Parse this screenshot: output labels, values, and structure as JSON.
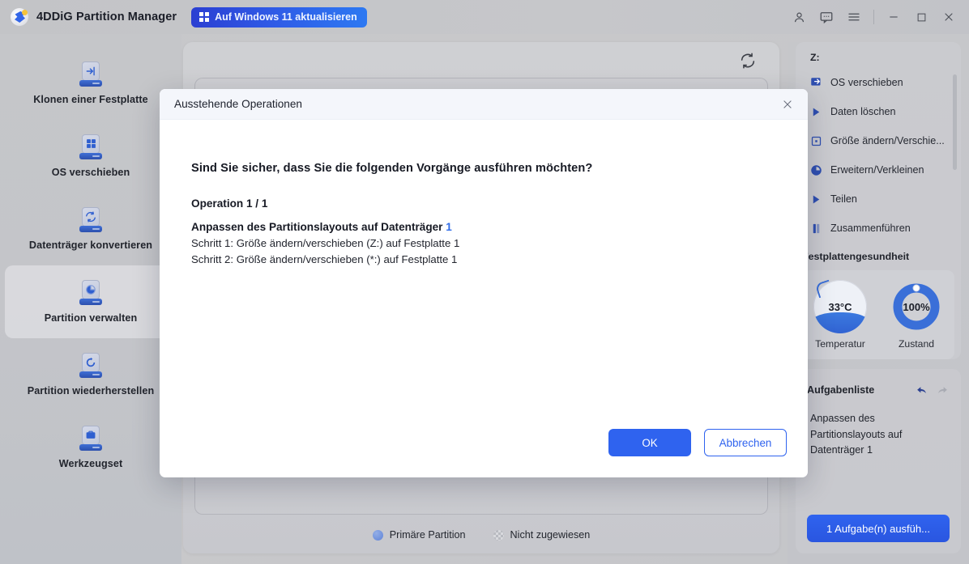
{
  "titlebar": {
    "app_title": "4DDiG Partition Manager",
    "upgrade_label": "Auf Windows 11 aktualisieren",
    "icons": {
      "account": "account-icon",
      "feedback": "feedback-icon",
      "menu": "hamburger-menu-icon",
      "minimize": "minimize-icon",
      "maximize": "maximize-icon",
      "close": "close-icon"
    }
  },
  "sidebar": {
    "items": [
      {
        "label": "Klonen einer Festplatte",
        "icon": "clone-disk-icon",
        "active": false
      },
      {
        "label": "OS verschieben",
        "icon": "migrate-os-icon",
        "active": false
      },
      {
        "label": "Datenträger konvertieren",
        "icon": "convert-disk-icon",
        "active": false
      },
      {
        "label": "Partition verwalten",
        "icon": "manage-partition-icon",
        "active": true
      },
      {
        "label": "Partition wiederherstellen",
        "icon": "recover-partition-icon",
        "active": false
      },
      {
        "label": "Werkzeugset",
        "icon": "toolkit-icon",
        "active": false
      }
    ]
  },
  "main": {
    "refresh_icon": "refresh-icon",
    "legend": [
      {
        "label": "Primäre Partition",
        "swatch": "primary"
      },
      {
        "label": "Nicht zugewiesen",
        "swatch": "unalloc"
      }
    ]
  },
  "right_panel": {
    "drive_label": "Z:",
    "menu": [
      {
        "label": "OS verschieben",
        "icon": "migrate-os-icon"
      },
      {
        "label": "Daten löschen",
        "icon": "wipe-data-icon"
      },
      {
        "label": "Größe ändern/Verschie...",
        "icon": "resize-move-icon"
      },
      {
        "label": "Erweitern/Verkleinen",
        "icon": "extend-shrink-icon"
      },
      {
        "label": "Teilen",
        "icon": "split-icon"
      },
      {
        "label": "Zusammenführen",
        "icon": "merge-icon"
      }
    ],
    "health_title": "Festplattengesundheit",
    "gauges": [
      {
        "value": "33°C",
        "label": "Temperatur",
        "type": "temperature"
      },
      {
        "value": "100%",
        "label": "Zustand",
        "type": "health"
      }
    ],
    "task_list": {
      "title": "Aufgabenliste",
      "undo_icon": "undo-icon",
      "redo_icon": "redo-icon",
      "entries": [
        "Anpassen des Partitionslayouts auf Datenträger 1"
      ],
      "run_button": "1 Aufgabe(n) ausfüh..."
    }
  },
  "modal": {
    "title": "Ausstehende Operationen",
    "close_icon": "close-icon",
    "question": "Sind Sie sicher, dass Sie die folgenden Vorgänge ausführen möchten?",
    "operation_counter": "Operation 1 / 1",
    "operation_title_prefix": "Anpassen des Partitionslayouts auf Datenträger ",
    "operation_disk_number": "1",
    "steps": [
      "Schritt 1: Größe ändern/verschieben (Z:) auf Festplatte 1",
      "Schritt 2: Größe ändern/verschieben (*:) auf Festplatte 1"
    ],
    "ok_label": "OK",
    "cancel_label": "Abbrechen"
  },
  "colors": {
    "accent_blue": "#2f63ef",
    "link_blue": "#2f6ce8",
    "window_bg": "#c6c7ca",
    "modal_header": "#f4f6fb"
  }
}
